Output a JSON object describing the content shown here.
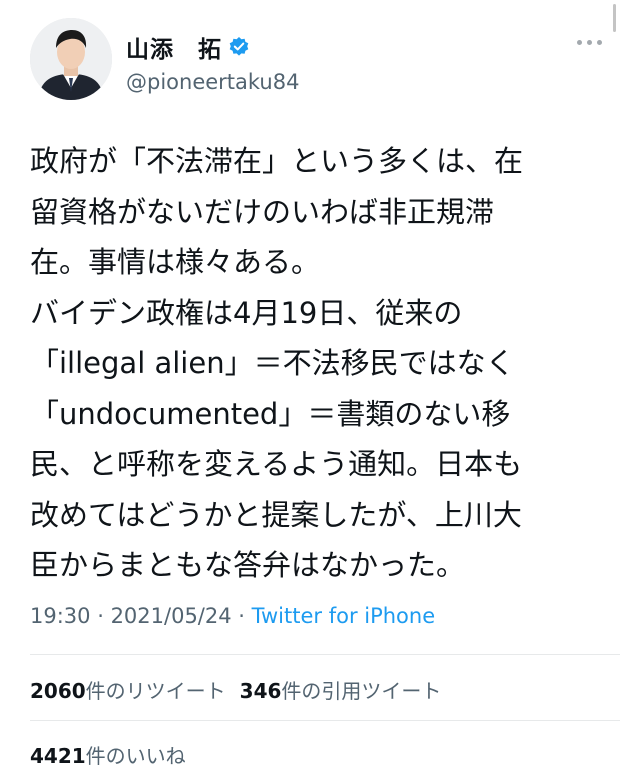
{
  "author": {
    "display_name": "山添　拓",
    "handle": "@pioneertaku84",
    "verified": true
  },
  "tweet": {
    "lines": [
      "政府が「不法滞在」という多くは、在",
      "留資格がないだけのいわば非正規滞",
      "在。事情は様々ある。",
      "バイデン政権は4月19日、従来の",
      "「illegal alien」＝不法移民ではなく",
      "「undocumented」＝書類のない移",
      "民、と呼称を変えるよう通知。日本も",
      "改めてはどうかと提案したが、上川大",
      "臣からまともな答弁はなかった。"
    ]
  },
  "meta": {
    "time": "19:30",
    "separator": " · ",
    "date": "2021/05/24",
    "source": "Twitter for iPhone"
  },
  "stats": {
    "retweets_count": "2060",
    "retweets_label": "件のリツイート",
    "quotes_count": "346",
    "quotes_label": "件の引用ツイート",
    "likes_count": "4421",
    "likes_label": "件のいいね"
  },
  "colors": {
    "text": "#0f1419",
    "secondary": "#536471",
    "link": "#1d9bf0",
    "verified": "#1d9bf0"
  },
  "icons": {
    "verified": "verified-badge-icon",
    "more": "more-options-icon"
  }
}
